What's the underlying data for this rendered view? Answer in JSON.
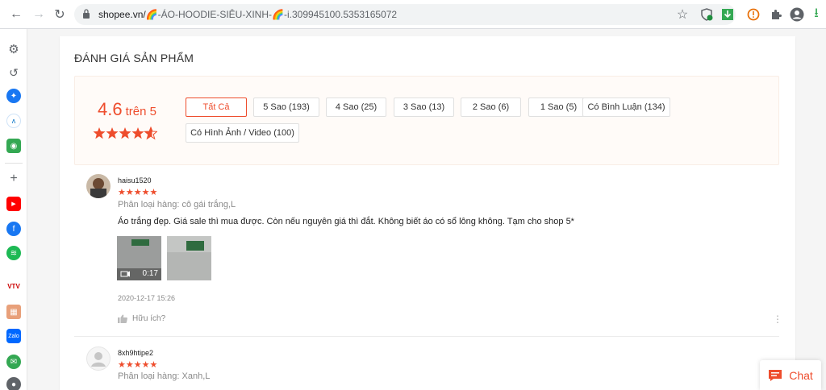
{
  "browser": {
    "url_host": "shopee.vn/",
    "url_path": "-ÁO-HOODIE-SIÊU-XINH-",
    "url_suffix": "-i.309945100.5353165072"
  },
  "review_section": {
    "heading": "ĐÁNH GIÁ SẢN PHẨM",
    "rating": "4.6",
    "rating_suffix": "trên 5",
    "rating_value": 4.6,
    "filters": [
      "Tất Cả",
      "5 Sao (193)",
      "4 Sao (25)",
      "3 Sao (13)",
      "2 Sao (6)",
      "1 Sao (5)",
      "Có Bình Luận (134)",
      "Có Hình Ảnh / Video (100)"
    ],
    "active_filter": "Tất Cả"
  },
  "reviews": [
    {
      "username": "haisu1520",
      "stars": "★★★★★",
      "rating": 5,
      "variant": "Phân loại hàng: cô gái trắng,L",
      "comment": "Áo trắng đẹp. Giá sale thì mua được. Còn nếu nguyên giá thì đắt. Không biết áo có sổ lông không. Tạm cho shop 5*",
      "video_duration": "0:17",
      "date": "2020-12-17 15:26",
      "helpful_label": "Hữu ích?"
    },
    {
      "username": "8xh9htipe2",
      "stars": "★★★★★",
      "rating": 5,
      "variant": "Phân loại hàng: Xanh,L"
    }
  ],
  "chat": {
    "label": "Chat"
  },
  "colors": {
    "accent": "#ee4d2d",
    "panel_bg": "#fffbf8"
  },
  "icons": {
    "sidebar": [
      "settings-icon",
      "history-icon",
      "messenger-icon",
      "store-icon",
      "gamepad-icon",
      "add-icon",
      "youtube-icon",
      "facebook-icon",
      "spotify-icon",
      "vtv-icon",
      "image-icon",
      "zalo-icon",
      "chat-icon",
      "notification-icon"
    ]
  }
}
